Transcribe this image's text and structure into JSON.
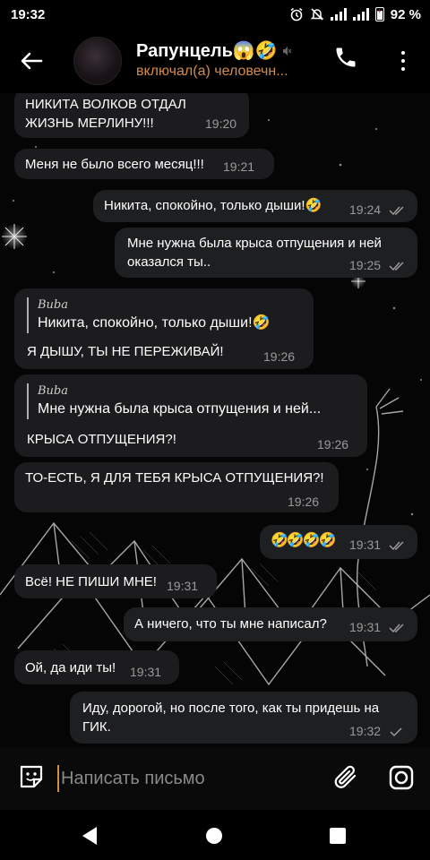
{
  "status_bar": {
    "time": "19:32",
    "battery": "92 %"
  },
  "header": {
    "title": "Рапунцель😱🤣",
    "status": "включал(а) человечн..."
  },
  "messages": [
    {
      "text": "НИКИТА ВОЛКОВ ОТДАЛ ЖИЗНЬ МЕРЛИНУ!!!",
      "time": "19:20"
    },
    {
      "text": "Меня не было всего месяц!!!",
      "time": "19:21"
    },
    {
      "text": "Никита, спокойно, только дыши!🤣",
      "time": "19:24"
    },
    {
      "text": "Мне нужна была крыса отпущения и ней оказался ты..",
      "time": "19:25"
    },
    {
      "quote_name": "Buba",
      "quote_text": "Никита, спокойно, только дыши!🤣",
      "text": "Я ДЫШУ, ТЫ НЕ ПЕРЕЖИВАЙ!",
      "time": "19:26"
    },
    {
      "quote_name": "Buba",
      "quote_text": "Мне нужна была крыса отпущения и ней...",
      "text": "КРЫСА ОТПУЩЕНИЯ?!",
      "time": "19:26"
    },
    {
      "text": "ТО-ЕСТЬ, Я ДЛЯ ТЕБЯ КРЫСА ОТПУЩЕНИЯ?!",
      "time": "19:26"
    },
    {
      "text": "🤣🤣🤣🤣",
      "time": "19:31"
    },
    {
      "text": "Всё! НЕ ПИШИ МНЕ!",
      "time": "19:31"
    },
    {
      "text": "А ничего, что ты мне написал?",
      "time": "19:31"
    },
    {
      "text": "Ой, да иди ты!",
      "time": "19:31"
    },
    {
      "text": "Иду, дорогой, но после того, как ты придешь на ГИК.",
      "time": "19:32"
    }
  ],
  "input": {
    "placeholder": "Написать письмо"
  },
  "colors": {
    "accent": "#d28b4a",
    "bubble": "#1c1c1e",
    "background": "#000000"
  }
}
